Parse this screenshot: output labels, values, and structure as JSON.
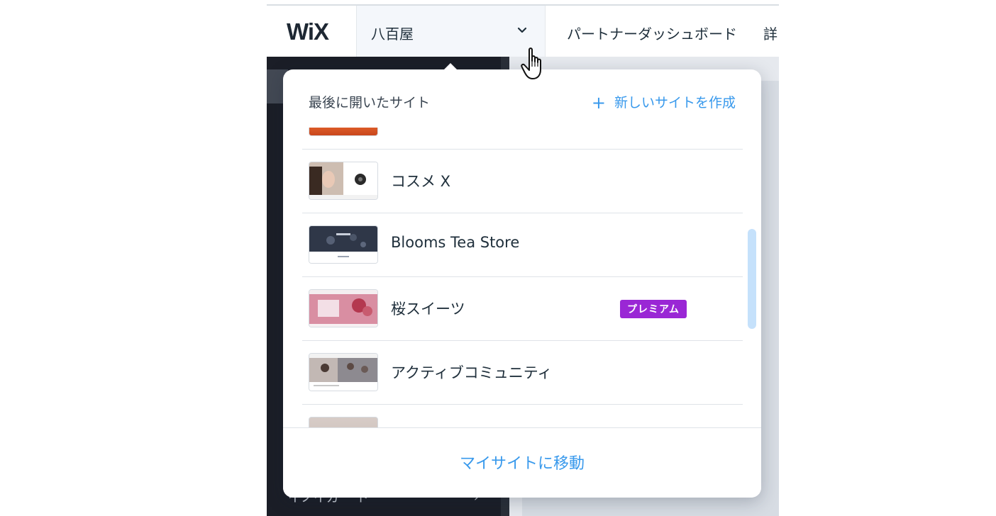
{
  "app": {
    "logo": "WiX",
    "current_site": "八百屋",
    "nav": {
      "partner_dashboard": "パートナーダッシュボード",
      "more": "詳"
    },
    "sidebar": {
      "bottom_text": "イノイガー ト",
      "bottom_arrow": "›"
    }
  },
  "dropdown": {
    "title": "最後に開いたサイト",
    "new_site": "新しいサイトを作成",
    "sites": [
      {
        "name": "",
        "premium": ""
      },
      {
        "name": "コスメ X",
        "premium": ""
      },
      {
        "name": "Blooms Tea Store",
        "premium": ""
      },
      {
        "name": "桜スイーツ",
        "premium": "プレミアム"
      },
      {
        "name": "アクティブコミュニティ",
        "premium": ""
      },
      {
        "name": "",
        "premium": ""
      }
    ],
    "footer_link": "マイサイトに移動"
  },
  "colors": {
    "accent": "#3899ec",
    "premium_badge": "#9a27d5",
    "dark_sidebar": "#1b1e27"
  },
  "icons": {
    "chevron": "chevron-down-icon",
    "plus": "plus-icon",
    "cursor": "hand-pointer-icon"
  }
}
